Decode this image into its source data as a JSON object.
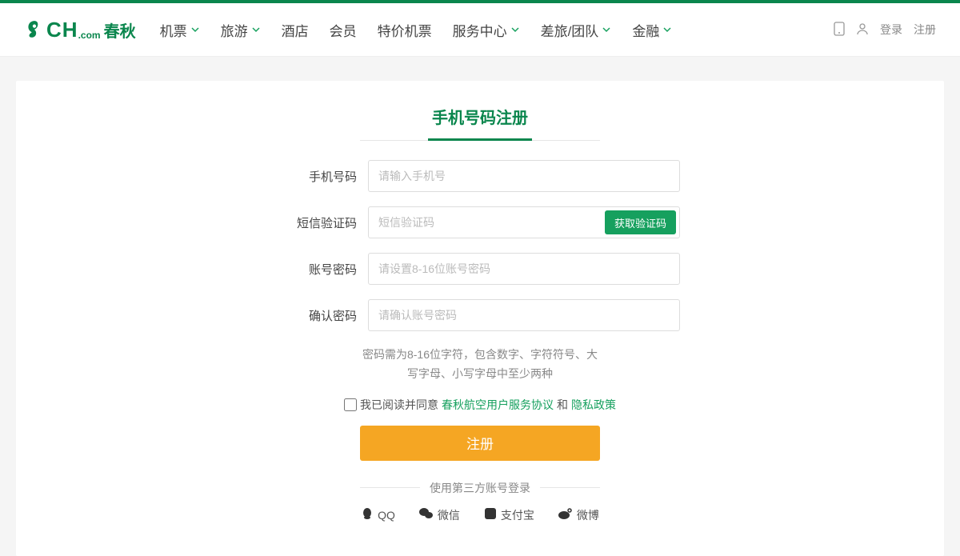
{
  "header": {
    "logo_text": "CH",
    "logo_suffix": ".com",
    "logo_cn": "春秋",
    "nav": [
      {
        "label": "机票",
        "dropdown": true
      },
      {
        "label": "旅游",
        "dropdown": true
      },
      {
        "label": "酒店",
        "dropdown": false
      },
      {
        "label": "会员",
        "dropdown": false
      },
      {
        "label": "特价机票",
        "dropdown": false
      },
      {
        "label": "服务中心",
        "dropdown": true
      },
      {
        "label": "差旅/团队",
        "dropdown": true
      },
      {
        "label": "金融",
        "dropdown": true
      }
    ],
    "login_label": "登录",
    "register_label": "注册"
  },
  "form": {
    "tab_title": "手机号码注册",
    "phone_label": "手机号码",
    "phone_placeholder": "请输入手机号",
    "code_label": "短信验证码",
    "code_placeholder": "短信验证码",
    "get_code_label": "获取验证码",
    "password_label": "账号密码",
    "password_placeholder": "请设置8-16位账号密码",
    "confirm_label": "确认密码",
    "confirm_placeholder": "请确认账号密码",
    "hint": "密码需为8-16位字符，包含数字、字符符号、大写字母、小写字母中至少两种",
    "agree_prefix": "我已阅读并同意",
    "agree_tos": "春秋航空用户服务协议",
    "agree_and": "和",
    "agree_privacy": "隐私政策",
    "submit_label": "注册",
    "third_title": "使用第三方账号登录",
    "third": [
      {
        "name": "QQ"
      },
      {
        "name": "微信"
      },
      {
        "name": "支付宝"
      },
      {
        "name": "微博"
      }
    ]
  },
  "colors": {
    "primary": "#0a864d",
    "accent": "#f5a623"
  }
}
